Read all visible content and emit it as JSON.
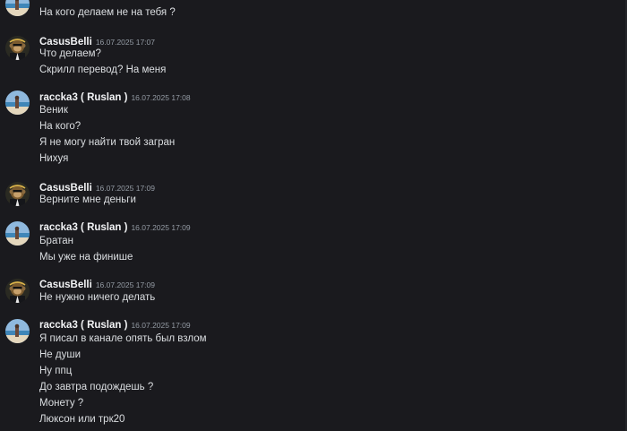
{
  "messages": {
    "prev": "На кого делаем не на тебя ?",
    "g1": {
      "author": "CasusBelli",
      "time": "16.07.2025 17:07",
      "lines": [
        "Что делаем?",
        "Скрилл перевод? На меня"
      ]
    },
    "g2": {
      "author": "raccka3 ( Ruslan )",
      "time": "16.07.2025 17:08",
      "lines": [
        "Веник",
        "На кого?",
        "Я не могу найти твой загран",
        "Нихуя"
      ]
    },
    "g3": {
      "author": "CasusBelli",
      "time": "16.07.2025 17:09",
      "lines": [
        "Верните мне деньги"
      ]
    },
    "g4": {
      "author": "raccka3 ( Ruslan )",
      "time": "16.07.2025 17:09",
      "lines": [
        "Братан",
        "Мы уже на финише"
      ]
    },
    "g5": {
      "author": "CasusBelli",
      "time": "16.07.2025 17:09",
      "lines": [
        "Не нужно ничего делать"
      ]
    },
    "g6": {
      "author": "raccka3 ( Ruslan )",
      "time": "16.07.2025 17:09",
      "lines": [
        "Я писал в канале опять был взлом",
        "Не души",
        "Ну ппц",
        "До завтра подождешь ?",
        "Монету ?",
        "Люксон или трк20"
      ]
    }
  },
  "avatars": {
    "casus": "monkey-in-suit",
    "raccka": "person-on-beach"
  }
}
